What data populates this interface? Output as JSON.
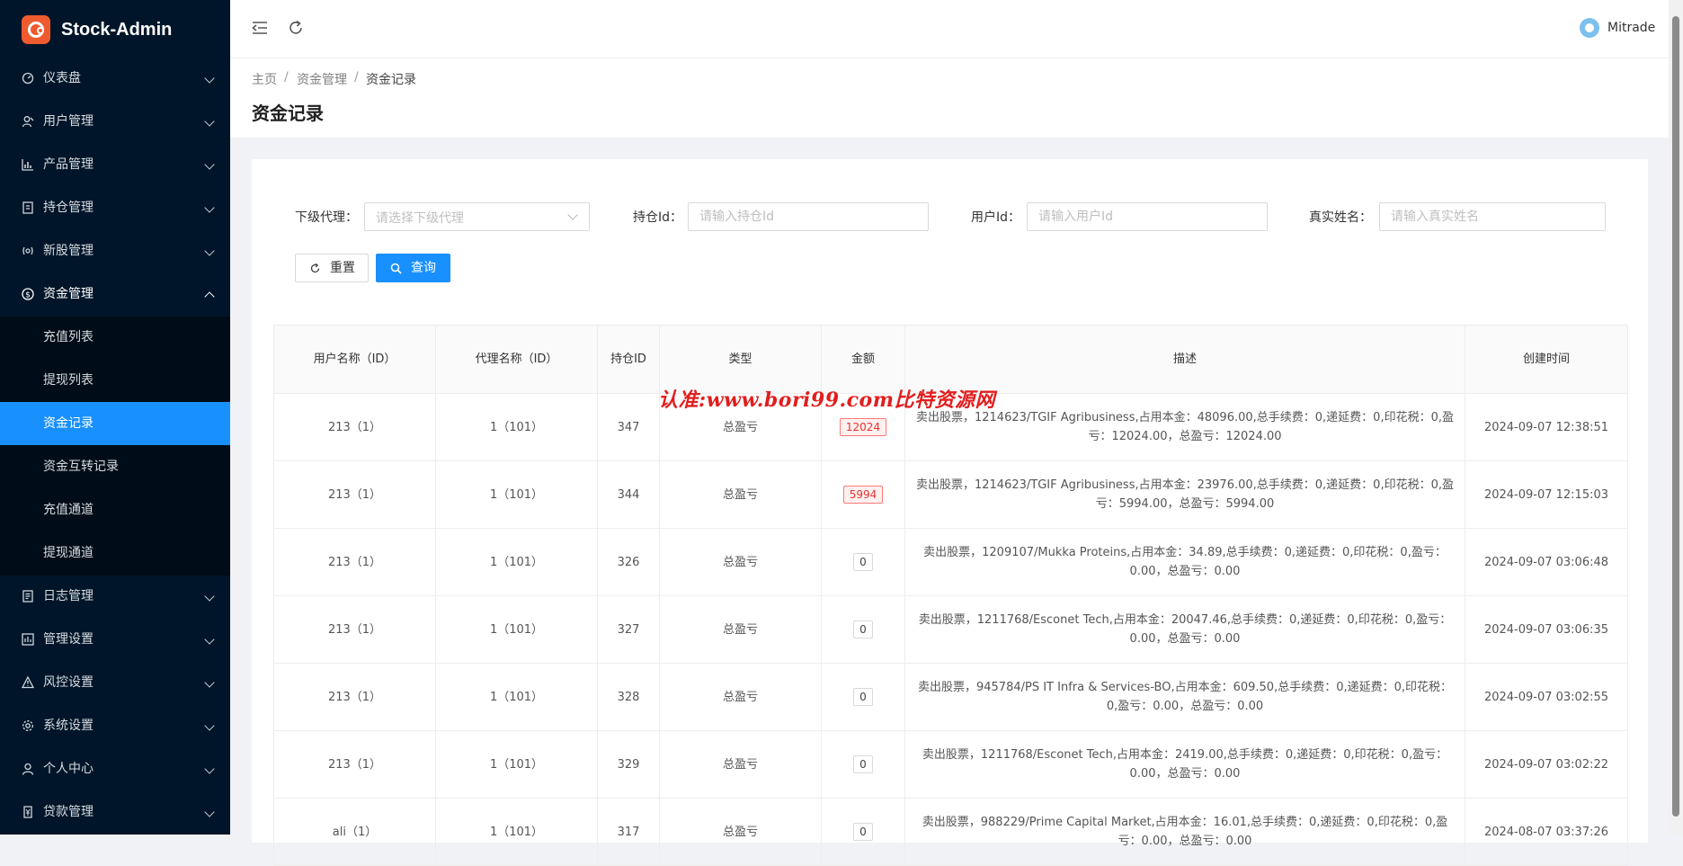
{
  "app": {
    "name": "Stock-Admin"
  },
  "sidebar": {
    "items": [
      {
        "label": "仪表盘",
        "icon": "dashboard-icon"
      },
      {
        "label": "用户管理",
        "icon": "users-icon"
      },
      {
        "label": "产品管理",
        "icon": "chart-icon"
      },
      {
        "label": "持仓管理",
        "icon": "position-icon"
      },
      {
        "label": "新股管理",
        "icon": "ipo-icon"
      },
      {
        "label": "资金管理",
        "icon": "dollar-icon",
        "expanded": true
      },
      {
        "label": "日志管理",
        "icon": "log-icon"
      },
      {
        "label": "管理设置",
        "icon": "manage-icon"
      },
      {
        "label": "风控设置",
        "icon": "warning-icon"
      },
      {
        "label": "系统设置",
        "icon": "gear-icon"
      },
      {
        "label": "个人中心",
        "icon": "user-icon"
      },
      {
        "label": "贷款管理",
        "icon": "loan-icon"
      }
    ],
    "subitems": [
      {
        "label": "充值列表"
      },
      {
        "label": "提现列表"
      },
      {
        "label": "资金记录",
        "active": true
      },
      {
        "label": "资金互转记录"
      },
      {
        "label": "充值通道"
      },
      {
        "label": "提现通道"
      }
    ]
  },
  "header": {
    "username": "Mitrade"
  },
  "breadcrumb": [
    "主页",
    "资金管理",
    "资金记录"
  ],
  "page_title": "资金记录",
  "filters": {
    "agent": {
      "label": "下级代理：",
      "placeholder": "请选择下级代理"
    },
    "position_id": {
      "label": "持仓Id：",
      "placeholder": "请输入持仓Id"
    },
    "user_id": {
      "label": "用户Id：",
      "placeholder": "请输入用户Id"
    },
    "real_name": {
      "label": "真实姓名：",
      "placeholder": "请输入真实姓名"
    },
    "reset_label": "重置",
    "query_label": "查询"
  },
  "table": {
    "columns": [
      "用户名称（ID）",
      "代理名称（ID）",
      "持仓ID",
      "类型",
      "金额",
      "描述",
      "创建时间"
    ],
    "rows": [
      {
        "user": "213（1）",
        "agent": "1（101）",
        "position_id": "347",
        "type": "总盈亏",
        "amount": "12024",
        "amount_style": "red",
        "desc": "卖出股票，1214623/TGIF Agribusiness,占用本金：48096.00,总手续费：0,递延费：0,印花税：0,盈亏：12024.00，总盈亏：12024.00",
        "created": "2024-09-07 12:38:51"
      },
      {
        "user": "213（1）",
        "agent": "1（101）",
        "position_id": "344",
        "type": "总盈亏",
        "amount": "5994",
        "amount_style": "red",
        "desc": "卖出股票，1214623/TGIF Agribusiness,占用本金：23976.00,总手续费：0,递延费：0,印花税：0,盈亏：5994.00，总盈亏：5994.00",
        "created": "2024-09-07 12:15:03"
      },
      {
        "user": "213（1）",
        "agent": "1（101）",
        "position_id": "326",
        "type": "总盈亏",
        "amount": "0",
        "amount_style": "gray",
        "desc": "卖出股票，1209107/Mukka Proteins,占用本金：34.89,总手续费：0,递延费：0,印花税：0,盈亏：0.00，总盈亏：0.00",
        "created": "2024-09-07 03:06:48"
      },
      {
        "user": "213（1）",
        "agent": "1（101）",
        "position_id": "327",
        "type": "总盈亏",
        "amount": "0",
        "amount_style": "gray",
        "desc": "卖出股票，1211768/Esconet Tech,占用本金：20047.46,总手续费：0,递延费：0,印花税：0,盈亏：0.00，总盈亏：0.00",
        "created": "2024-09-07 03:06:35"
      },
      {
        "user": "213（1）",
        "agent": "1（101）",
        "position_id": "328",
        "type": "总盈亏",
        "amount": "0",
        "amount_style": "gray",
        "desc": "卖出股票，945784/PS IT Infra & Services-BO,占用本金：609.50,总手续费：0,递延费：0,印花税：0,盈亏：0.00，总盈亏：0.00",
        "created": "2024-09-07 03:02:55"
      },
      {
        "user": "213（1）",
        "agent": "1（101）",
        "position_id": "329",
        "type": "总盈亏",
        "amount": "0",
        "amount_style": "gray",
        "desc": "卖出股票，1211768/Esconet Tech,占用本金：2419.00,总手续费：0,递延费：0,印花税：0,盈亏：0.00，总盈亏：0.00",
        "created": "2024-09-07 03:02:22"
      },
      {
        "user": "ali（1）",
        "agent": "1（101）",
        "position_id": "317",
        "type": "总盈亏",
        "amount": "0",
        "amount_style": "gray",
        "desc": "卖出股票，988229/Prime Capital Market,占用本金：16.01,总手续费：0,递延费：0,印花税：0,盈亏：0.00，总盈亏：0.00",
        "created": "2024-08-07 03:37:26"
      }
    ]
  },
  "watermark": "认准:www.bori99.com比特资源网",
  "colors": {
    "sidebar_bg": "#001529",
    "submenu_bg": "#000c17",
    "accent": "#1890ff",
    "logo": "#ef5b2f",
    "tag_red": "#e8302f"
  }
}
